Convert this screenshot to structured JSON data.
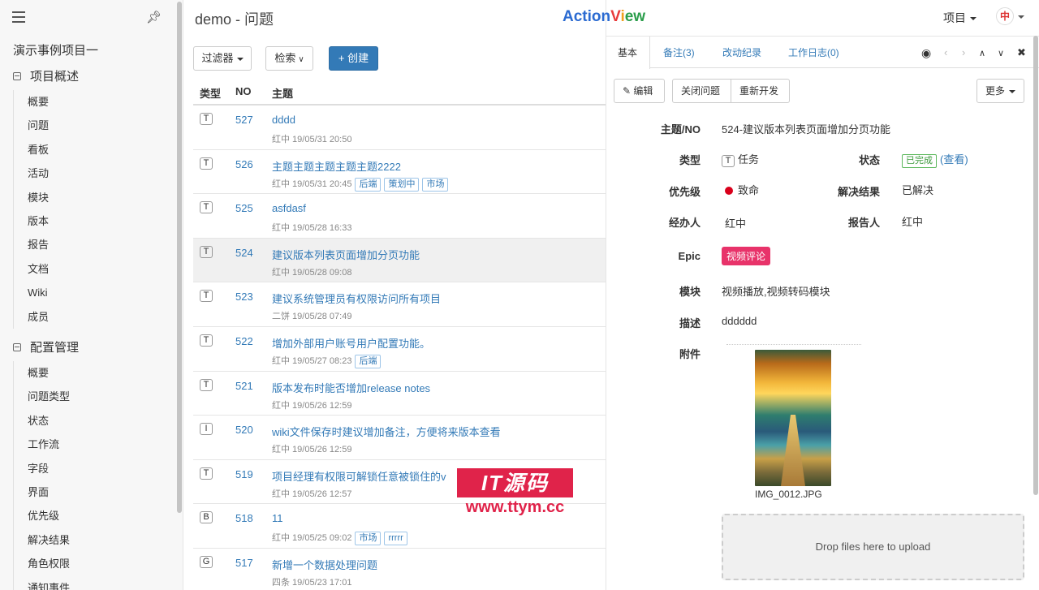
{
  "sidebar": {
    "project_name": "演示事例项目一",
    "group1": "项目概述",
    "group1_items": [
      "概要",
      "问题",
      "看板",
      "活动",
      "模块",
      "版本",
      "报告",
      "文档",
      "Wiki",
      "成员"
    ],
    "group2": "配置管理",
    "group2_items": [
      "概要",
      "问题类型",
      "状态",
      "工作流",
      "字段",
      "界面",
      "优先级",
      "解决结果",
      "角色权限",
      "通知事件"
    ]
  },
  "list": {
    "title": "demo - 问题",
    "filter_label": "过滤器",
    "search_label": "检索",
    "create_label": "+ 创建",
    "col_type": "类型",
    "col_no": "NO",
    "col_subject": "主题",
    "rows": [
      {
        "type": "T",
        "no": "527",
        "subject": "dddd",
        "meta": "红中  19/05/31 20:50",
        "labels": []
      },
      {
        "type": "T",
        "no": "526",
        "subject": "主题主题主题主题主题2222",
        "meta": "红中  19/05/31 20:45",
        "labels": [
          "后端",
          "策划中",
          "市场"
        ]
      },
      {
        "type": "T",
        "no": "525",
        "subject": "asfdasf",
        "meta": "红中  19/05/28 16:33",
        "labels": []
      },
      {
        "type": "T",
        "no": "524",
        "subject": "建议版本列表页面增加分页功能",
        "meta": "红中  19/05/28 09:08",
        "labels": []
      },
      {
        "type": "T",
        "no": "523",
        "subject": "建议系统管理员有权限访问所有项目",
        "meta": "二饼  19/05/28 07:49",
        "labels": []
      },
      {
        "type": "T",
        "no": "522",
        "subject": "增加外部用户账号用户配置功能。",
        "meta": "红中  19/05/27 08:23",
        "labels": [
          "后端"
        ]
      },
      {
        "type": "T",
        "no": "521",
        "subject": "版本发布时能否增加release notes",
        "meta": "红中  19/05/26 12:59",
        "labels": []
      },
      {
        "type": "I",
        "no": "520",
        "subject": "wiki文件保存时建议增加备注，方便将来版本查看",
        "meta": "红中  19/05/26 12:59",
        "labels": []
      },
      {
        "type": "T",
        "no": "519",
        "subject": "项目经理有权限可解锁任意被锁住的v",
        "meta": "红中  19/05/26 12:57",
        "labels": []
      },
      {
        "type": "B",
        "no": "518",
        "subject": "11",
        "meta": "红中  19/05/25 09:02",
        "labels": [
          "市场",
          "rrrrr"
        ]
      },
      {
        "type": "G",
        "no": "517",
        "subject": "新增一个数据处理问题",
        "meta": "四条  19/05/23 17:01",
        "labels": []
      }
    ]
  },
  "watermark": {
    "line1": "IT源码",
    "line2": "www.ttym.cc"
  },
  "header": {
    "logo_parts": [
      "Action",
      "V",
      "i",
      "ew"
    ],
    "project_menu": "项目",
    "lang": "中"
  },
  "detail": {
    "tabs": [
      "基本",
      "备注(3)",
      "改动纪录",
      "工作日志(0)"
    ],
    "edit_label": "编辑",
    "close_label": "关闭问题",
    "reopen_label": "重新开发",
    "more_label": "更多",
    "fields": {
      "subject_label": "主题/NO",
      "subject_value": "524-建议版本列表页面增加分页功能",
      "type_label": "类型",
      "type_value": "任务",
      "type_icon": "T",
      "status_label": "状态",
      "status_value": "已完成",
      "status_link": "(查看)",
      "priority_label": "优先级",
      "priority_value": "致命",
      "resolution_label": "解决结果",
      "resolution_value": "已解决",
      "assignee_label": "经办人",
      "assignee_value": "红中",
      "reporter_label": "报告人",
      "reporter_value": "红中",
      "epic_label": "Epic",
      "epic_value": "视频评论",
      "module_label": "模块",
      "module_value": "视频播放,视频转码模块",
      "desc_label": "描述",
      "desc_value": "dddddd",
      "attach_label": "附件",
      "attach_name": "IMG_0012.JPG"
    },
    "drop_text": "Drop files here to upload"
  },
  "colors": {
    "accent": "#337ab7",
    "epic": "#e8336a",
    "priority": "#d9001b",
    "done": "#5cb85c"
  }
}
